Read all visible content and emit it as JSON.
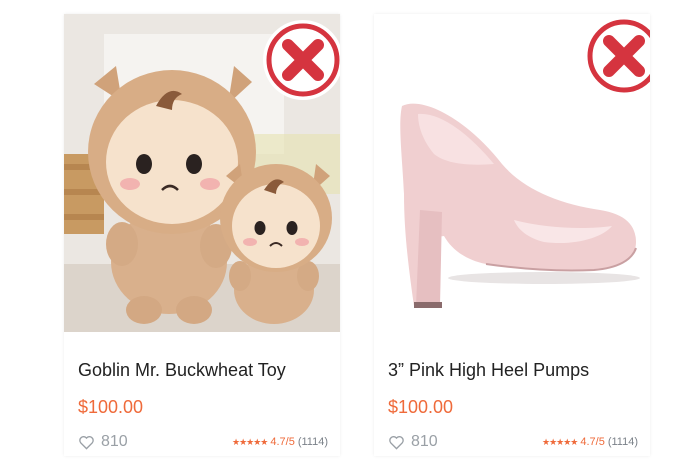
{
  "colors": {
    "accent_price": "#ef6a3a",
    "remove_red": "#d5343f",
    "muted": "#9aa0a6"
  },
  "products": [
    {
      "title": "Goblin Mr. Buckwheat Toy",
      "price": "$100.00",
      "likes": "810",
      "stars": "★★★★★",
      "rating": "4.7/5",
      "reviews": "(1114)",
      "image": "plush-toy-pair",
      "remove_icon": "close-icon"
    },
    {
      "title": "3” Pink High Heel Pumps",
      "price": "$100.00",
      "likes": "810",
      "stars": "★★★★★",
      "rating": "4.7/5",
      "reviews": "(1114)",
      "image": "pink-heel-pump",
      "remove_icon": "close-icon"
    }
  ]
}
